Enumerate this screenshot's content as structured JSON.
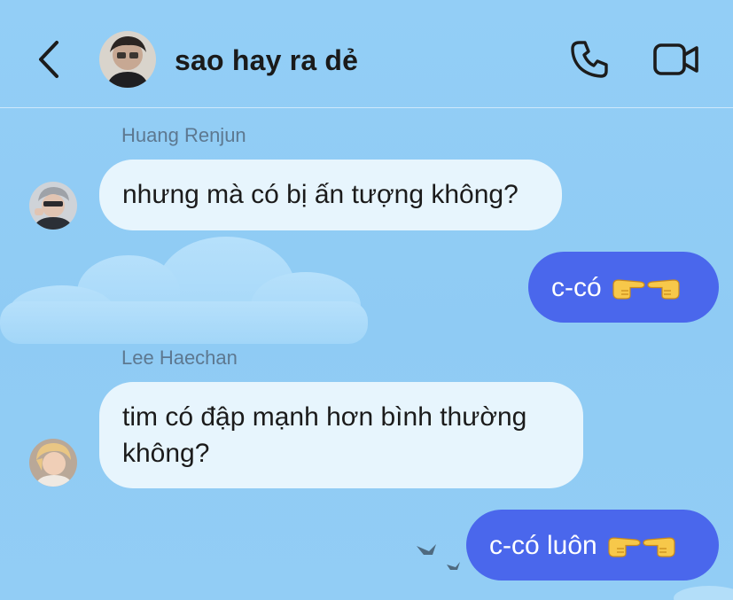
{
  "header": {
    "title": "sao hay ra dẻ",
    "icons": {
      "back": "chevron-left-icon",
      "call": "phone-icon",
      "video": "video-camera-icon"
    }
  },
  "messages": [
    {
      "direction": "incoming",
      "sender": "Huang Renjun",
      "text": "nhưng mà có bị ấn tượng không?"
    },
    {
      "direction": "outgoing",
      "text": "c-có",
      "emoji": "👉👈"
    },
    {
      "direction": "incoming",
      "sender": "Lee Haechan",
      "text_lines": [
        "tim có đập mạnh hơn bình thường",
        "không?"
      ]
    },
    {
      "direction": "outgoing",
      "text": "c-có luôn",
      "emoji": "👉👈"
    }
  ],
  "colors": {
    "background": "#92cdf5",
    "incoming_bubble": "#e7f5fd",
    "outgoing_bubble": "#4a67ec",
    "sender_name": "#5d7890",
    "title": "#1a1a1a"
  }
}
